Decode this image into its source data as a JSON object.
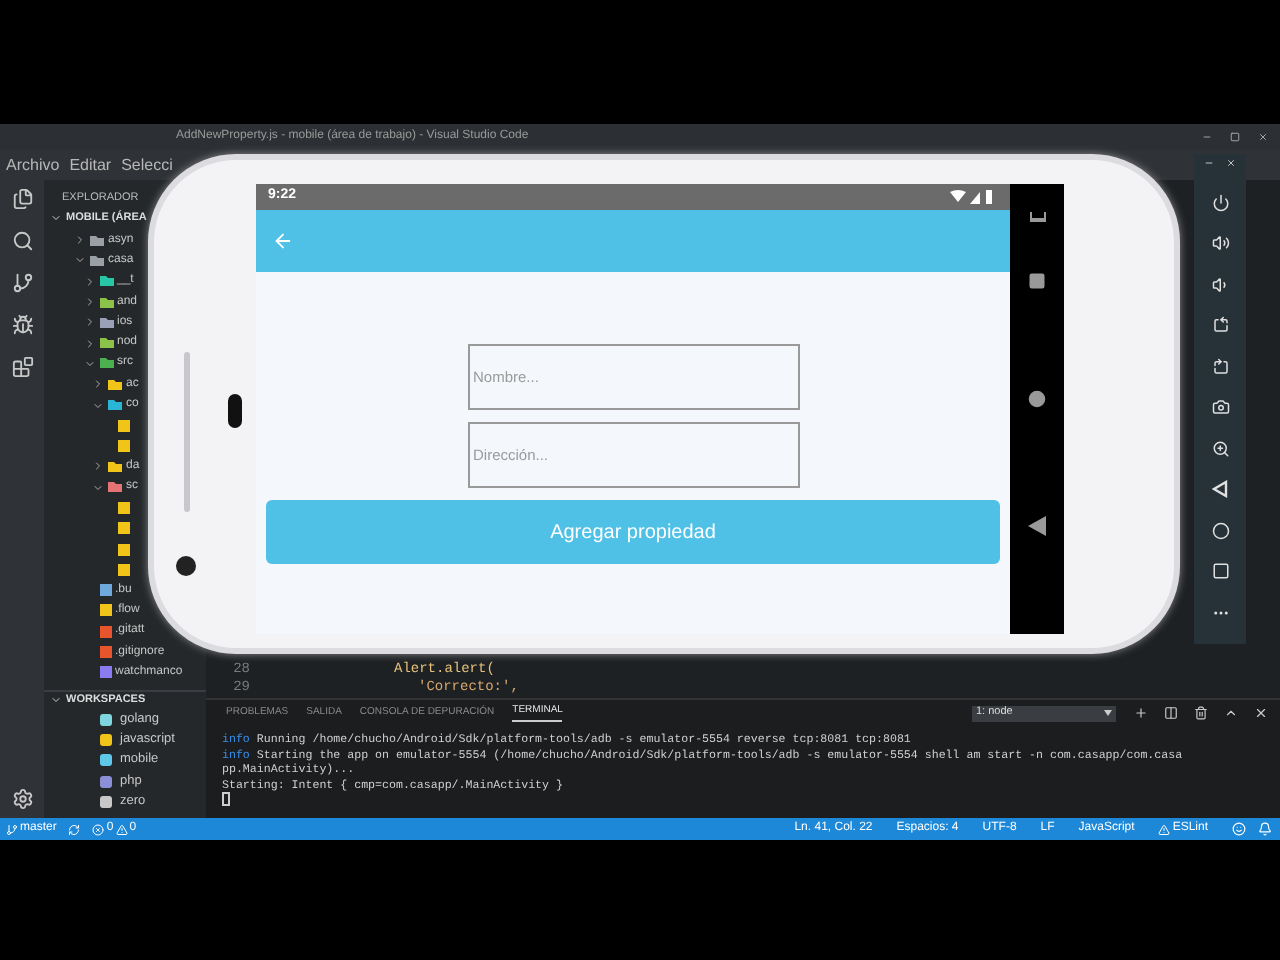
{
  "window": {
    "title": "AddNewProperty.js - mobile (área de trabajo) - Visual Studio Code"
  },
  "menu": [
    "Archivo",
    "Editar",
    "Selecci"
  ],
  "sidebar": {
    "title": "EXPLORADOR",
    "workspace": "MOBILE (ÁREA",
    "tree": [
      {
        "kind": "folder",
        "label": "asyn",
        "color": "#9aa0a6",
        "expanded": false
      },
      {
        "kind": "folder",
        "label": "casa",
        "color": "#9aa0a6",
        "expanded": true,
        "children": [
          {
            "kind": "folder",
            "label": "__t",
            "color": "#26c6a6",
            "expanded": false
          },
          {
            "kind": "folder",
            "label": "and",
            "color": "#8bc34a",
            "expanded": false
          },
          {
            "kind": "folder",
            "label": "ios",
            "color": "#9aa0b6",
            "expanded": false
          },
          {
            "kind": "folder",
            "label": "nod",
            "color": "#8bc34a",
            "expanded": false
          },
          {
            "kind": "folder",
            "label": "src",
            "color": "#4caf50",
            "expanded": true,
            "children": [
              {
                "kind": "folder",
                "label": "ac",
                "color": "#f0c419",
                "expanded": false
              },
              {
                "kind": "folder",
                "label": "co",
                "color": "#29b6d6",
                "expanded": true,
                "children": [
                  {
                    "kind": "file",
                    "color": "#f0c419"
                  },
                  {
                    "kind": "file",
                    "color": "#f0c419"
                  }
                ]
              },
              {
                "kind": "folder",
                "label": "da",
                "color": "#f0c419",
                "expanded": false
              },
              {
                "kind": "folder",
                "label": "sc",
                "color": "#e57373",
                "expanded": true,
                "children": [
                  {
                    "kind": "file",
                    "color": "#f0c419"
                  },
                  {
                    "kind": "file",
                    "color": "#f0c419"
                  },
                  {
                    "kind": "file",
                    "color": "#f0c419"
                  },
                  {
                    "kind": "file",
                    "color": "#f0c419"
                  }
                ]
              }
            ]
          },
          {
            "kind": "file",
            "label": ".bu",
            "color": "#6fa8dc"
          },
          {
            "kind": "file",
            "label": ".flow",
            "color": "#f0c419"
          },
          {
            "kind": "file",
            "label": ".gitatt",
            "color": "#e8552d"
          },
          {
            "kind": "file",
            "label": ".gitignore",
            "color": "#e8552d"
          },
          {
            "kind": "file",
            "label": "watchmanco",
            "color": "#8a7cf0"
          }
        ]
      }
    ],
    "workspaces_title": "WORKSPACES",
    "workspaces": [
      {
        "label": "golang",
        "color": "#7fd6e0"
      },
      {
        "label": "javascript",
        "color": "#f0c419"
      },
      {
        "label": "mobile",
        "color": "#5fc8e8"
      },
      {
        "label": "php",
        "color": "#8a8fd8"
      },
      {
        "label": "zero",
        "color": "#c8c8c8"
      }
    ]
  },
  "editor": {
    "lines": [
      {
        "number": "28",
        "kind": "call",
        "code": "Alert.alert("
      },
      {
        "number": "29",
        "kind": "string",
        "code": "'Correcto:',"
      }
    ]
  },
  "panel": {
    "tabs": [
      {
        "label": "PROBLEMAS",
        "selected": false
      },
      {
        "label": "SALIDA",
        "selected": false
      },
      {
        "label": "CONSOLA DE DEPURACIÓN",
        "selected": false
      },
      {
        "label": "TERMINAL",
        "selected": true
      }
    ],
    "terminal_select": "1: node",
    "terminal": [
      {
        "prefix": "info",
        "text": "Running /home/chucho/Android/Sdk/platform-tools/adb -s emulator-5554 reverse tcp:8081 tcp:8081"
      },
      {
        "prefix": "info",
        "text": "Starting the app on emulator-5554 (/home/chucho/Android/Sdk/platform-tools/adb -s emulator-5554 shell am start -n com.casapp/com.casa"
      },
      {
        "text": "pp.MainActivity)..."
      },
      {
        "text": "Starting: Intent { cmp=com.casapp/.MainActivity }"
      }
    ]
  },
  "status_bar": {
    "branch": "master",
    "errors": "0",
    "warnings": "0",
    "items": [
      "Ln. 41, Col. 22",
      "Espacios: 4",
      "UTF-8",
      "LF",
      "JavaScript"
    ],
    "linter": "ESLint"
  },
  "phone": {
    "time": "9:22",
    "fields": [
      {
        "placeholder": "Nombre..."
      },
      {
        "placeholder": "Dirección..."
      }
    ],
    "button": "Agregar propiedad"
  }
}
